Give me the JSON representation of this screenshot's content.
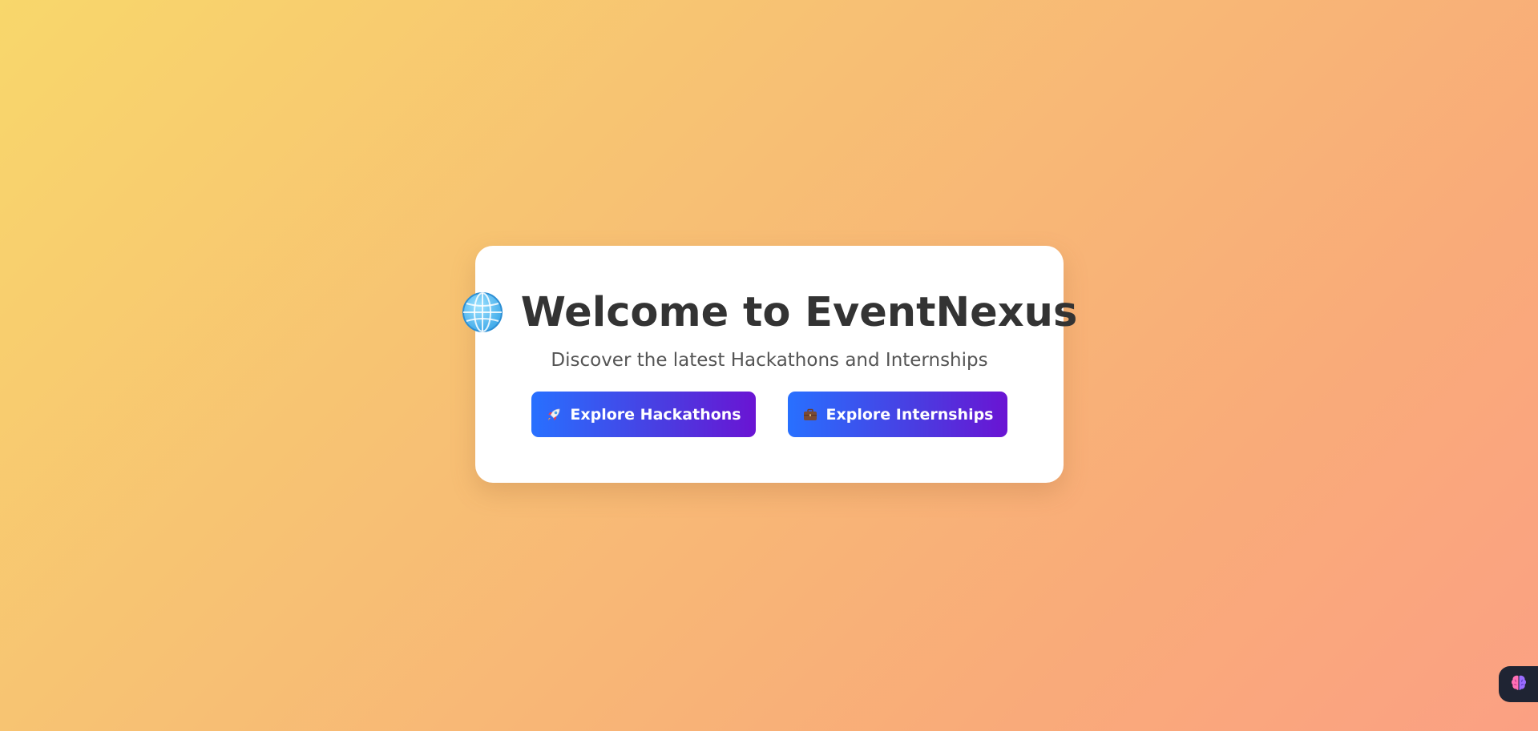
{
  "hero": {
    "title": "Welcome to EventNexus",
    "subtitle": "Discover the latest Hackathons and Internships",
    "icon": "globe-icon"
  },
  "actions": {
    "hackathons": {
      "label": "Explore Hackathons",
      "icon": "rocket-icon"
    },
    "internships": {
      "label": "Explore Internships",
      "icon": "briefcase-icon"
    }
  },
  "widget": {
    "icon": "brain-icon"
  },
  "colors": {
    "background_start": "#f8d76b",
    "background_end": "#fba083",
    "button_start": "#2870ff",
    "button_end": "#6a14d3",
    "title": "#333333",
    "subtitle": "#555555"
  }
}
